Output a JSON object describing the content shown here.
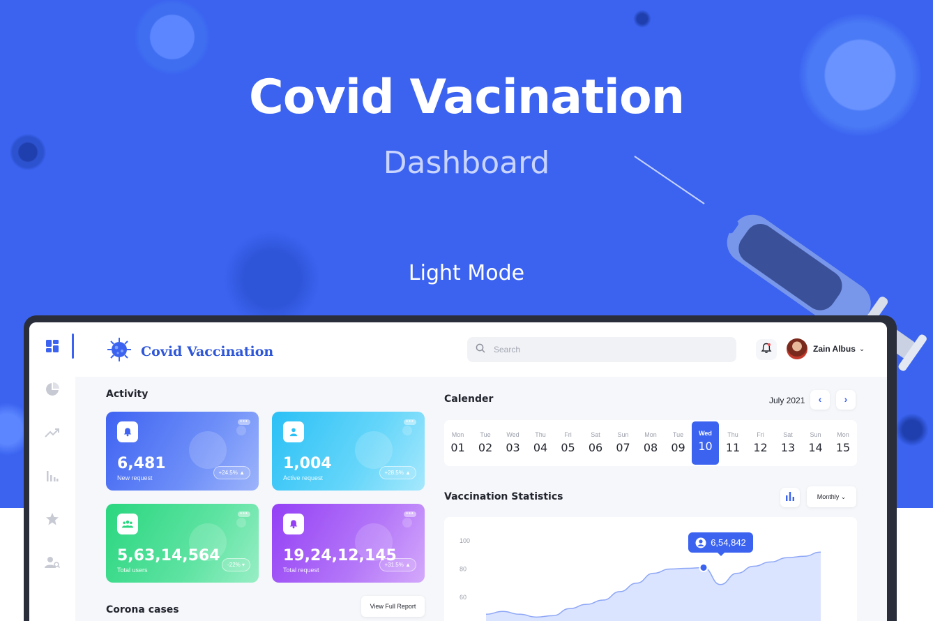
{
  "hero": {
    "title": "Covid Vacination",
    "subtitle": "Dashboard",
    "mode": "Light Mode"
  },
  "colors": {
    "accent": "#3b63f0",
    "hero_bg": "#3b63f0",
    "card_new": "#4a6cf7",
    "card_active": "#39c8f6",
    "card_users": "#31d98a",
    "card_total": "#9b4cf7"
  },
  "sidebar": {
    "items": [
      {
        "icon": "dashboard-icon",
        "active": true
      },
      {
        "icon": "pie-chart-icon"
      },
      {
        "icon": "trend-icon"
      },
      {
        "icon": "bar-chart-icon"
      },
      {
        "icon": "star-icon"
      },
      {
        "icon": "user-search-icon"
      }
    ]
  },
  "header": {
    "brand": "Covid Vaccination",
    "search_placeholder": "Search",
    "user_name": "Zain Albus"
  },
  "activity": {
    "title": "Activity",
    "cards": [
      {
        "value": "6,481",
        "label": "New request",
        "change": "+24.5% ▲"
      },
      {
        "value": "1,004",
        "label": "Active request",
        "change": "+28.5% ▲"
      },
      {
        "value": "5,63,14,564",
        "label": "Total users",
        "change": "-22% ▾"
      },
      {
        "value": "19,24,12,145",
        "label": "Total request",
        "change": "+31.5% ▲"
      }
    ]
  },
  "corona": {
    "title": "Corona cases",
    "report_button": "View Full Report"
  },
  "calendar": {
    "title": "Calender",
    "month": "July 2021",
    "days": [
      {
        "name": "Mon",
        "date": "01"
      },
      {
        "name": "Tue",
        "date": "02"
      },
      {
        "name": "Wed",
        "date": "03"
      },
      {
        "name": "Thu",
        "date": "04"
      },
      {
        "name": "Fri",
        "date": "05"
      },
      {
        "name": "Sat",
        "date": "06"
      },
      {
        "name": "Sun",
        "date": "07"
      },
      {
        "name": "Mon",
        "date": "08"
      },
      {
        "name": "Tue",
        "date": "09"
      },
      {
        "name": "Wed",
        "date": "10",
        "active": true
      },
      {
        "name": "Thu",
        "date": "11"
      },
      {
        "name": "Fri",
        "date": "12"
      },
      {
        "name": "Sat",
        "date": "13"
      },
      {
        "name": "Sun",
        "date": "14"
      },
      {
        "name": "Mon",
        "date": "15"
      }
    ]
  },
  "stats": {
    "title": "Vaccination Statistics",
    "period": "Monthly",
    "tooltip": "6,54,842",
    "y_ticks": [
      "100",
      "80",
      "60"
    ]
  },
  "chart_data": {
    "type": "area",
    "title": "Vaccination Statistics",
    "xlabel": "",
    "ylabel": "",
    "ylim": [
      50,
      100
    ],
    "y_ticks": [
      100,
      80,
      60
    ],
    "x": [
      0,
      1,
      2,
      3,
      4,
      5,
      6,
      7,
      8,
      9,
      10,
      11,
      12,
      13,
      14,
      15,
      16,
      17,
      18,
      19,
      20
    ],
    "values": [
      48,
      50,
      48,
      46,
      47,
      52,
      55,
      58,
      64,
      70,
      77,
      80,
      80.5,
      81,
      69,
      77,
      82,
      85,
      88,
      89,
      92
    ],
    "highlight": {
      "index": 13,
      "label": "6,54,842"
    }
  }
}
